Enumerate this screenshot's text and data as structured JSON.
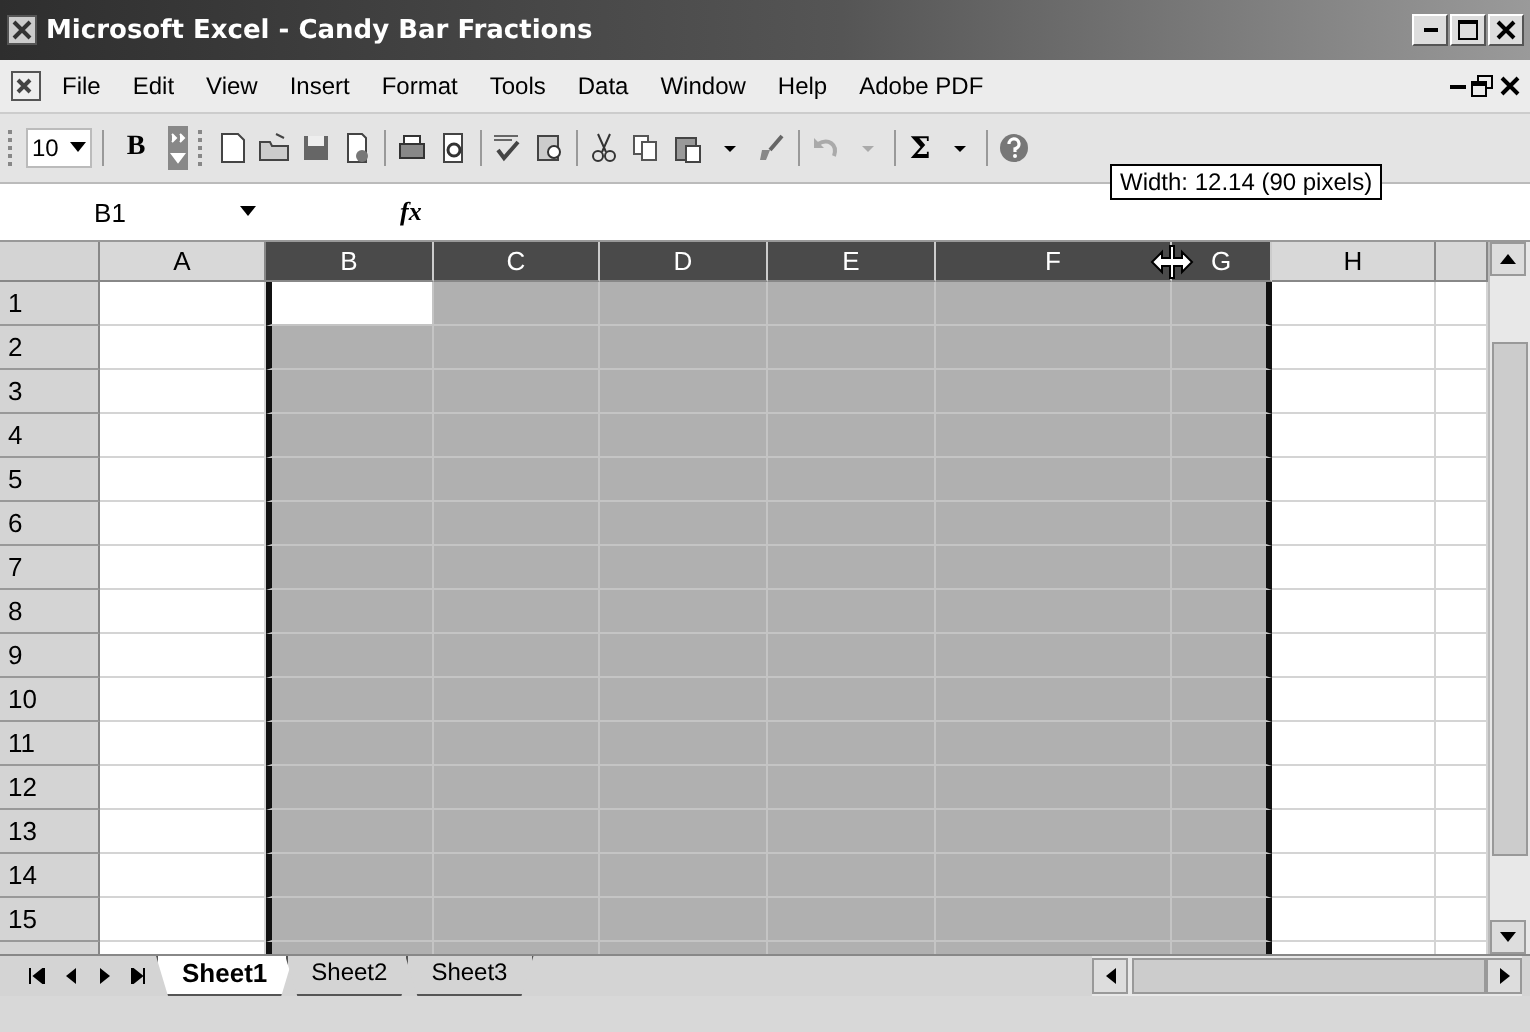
{
  "window": {
    "title": "Microsoft Excel - Candy Bar Fractions"
  },
  "menu": [
    "File",
    "Edit",
    "View",
    "Insert",
    "Format",
    "Tools",
    "Data",
    "Window",
    "Help",
    "Adobe PDF"
  ],
  "toolbar": {
    "font_size": "10",
    "bold_label": "B",
    "autosum_label": "Σ"
  },
  "formula_bar": {
    "name_box": "B1",
    "function_label": "fx"
  },
  "tooltip": "Width: 12.14 (90 pixels)",
  "columns": [
    {
      "label": "A",
      "selected": false
    },
    {
      "label": "B",
      "selected": true
    },
    {
      "label": "C",
      "selected": true
    },
    {
      "label": "D",
      "selected": true
    },
    {
      "label": "E",
      "selected": true
    },
    {
      "label": "F",
      "selected": true
    },
    {
      "label": "G",
      "selected": true
    },
    {
      "label": "H",
      "selected": false
    }
  ],
  "rows": [
    "1",
    "2",
    "3",
    "4",
    "5",
    "6",
    "7",
    "8",
    "9",
    "10",
    "11",
    "12",
    "13",
    "14",
    "15"
  ],
  "sheet_tabs": [
    {
      "label": "Sheet1",
      "selected": true
    },
    {
      "label": "Sheet2",
      "selected": false
    },
    {
      "label": "Sheet3",
      "selected": false
    }
  ]
}
